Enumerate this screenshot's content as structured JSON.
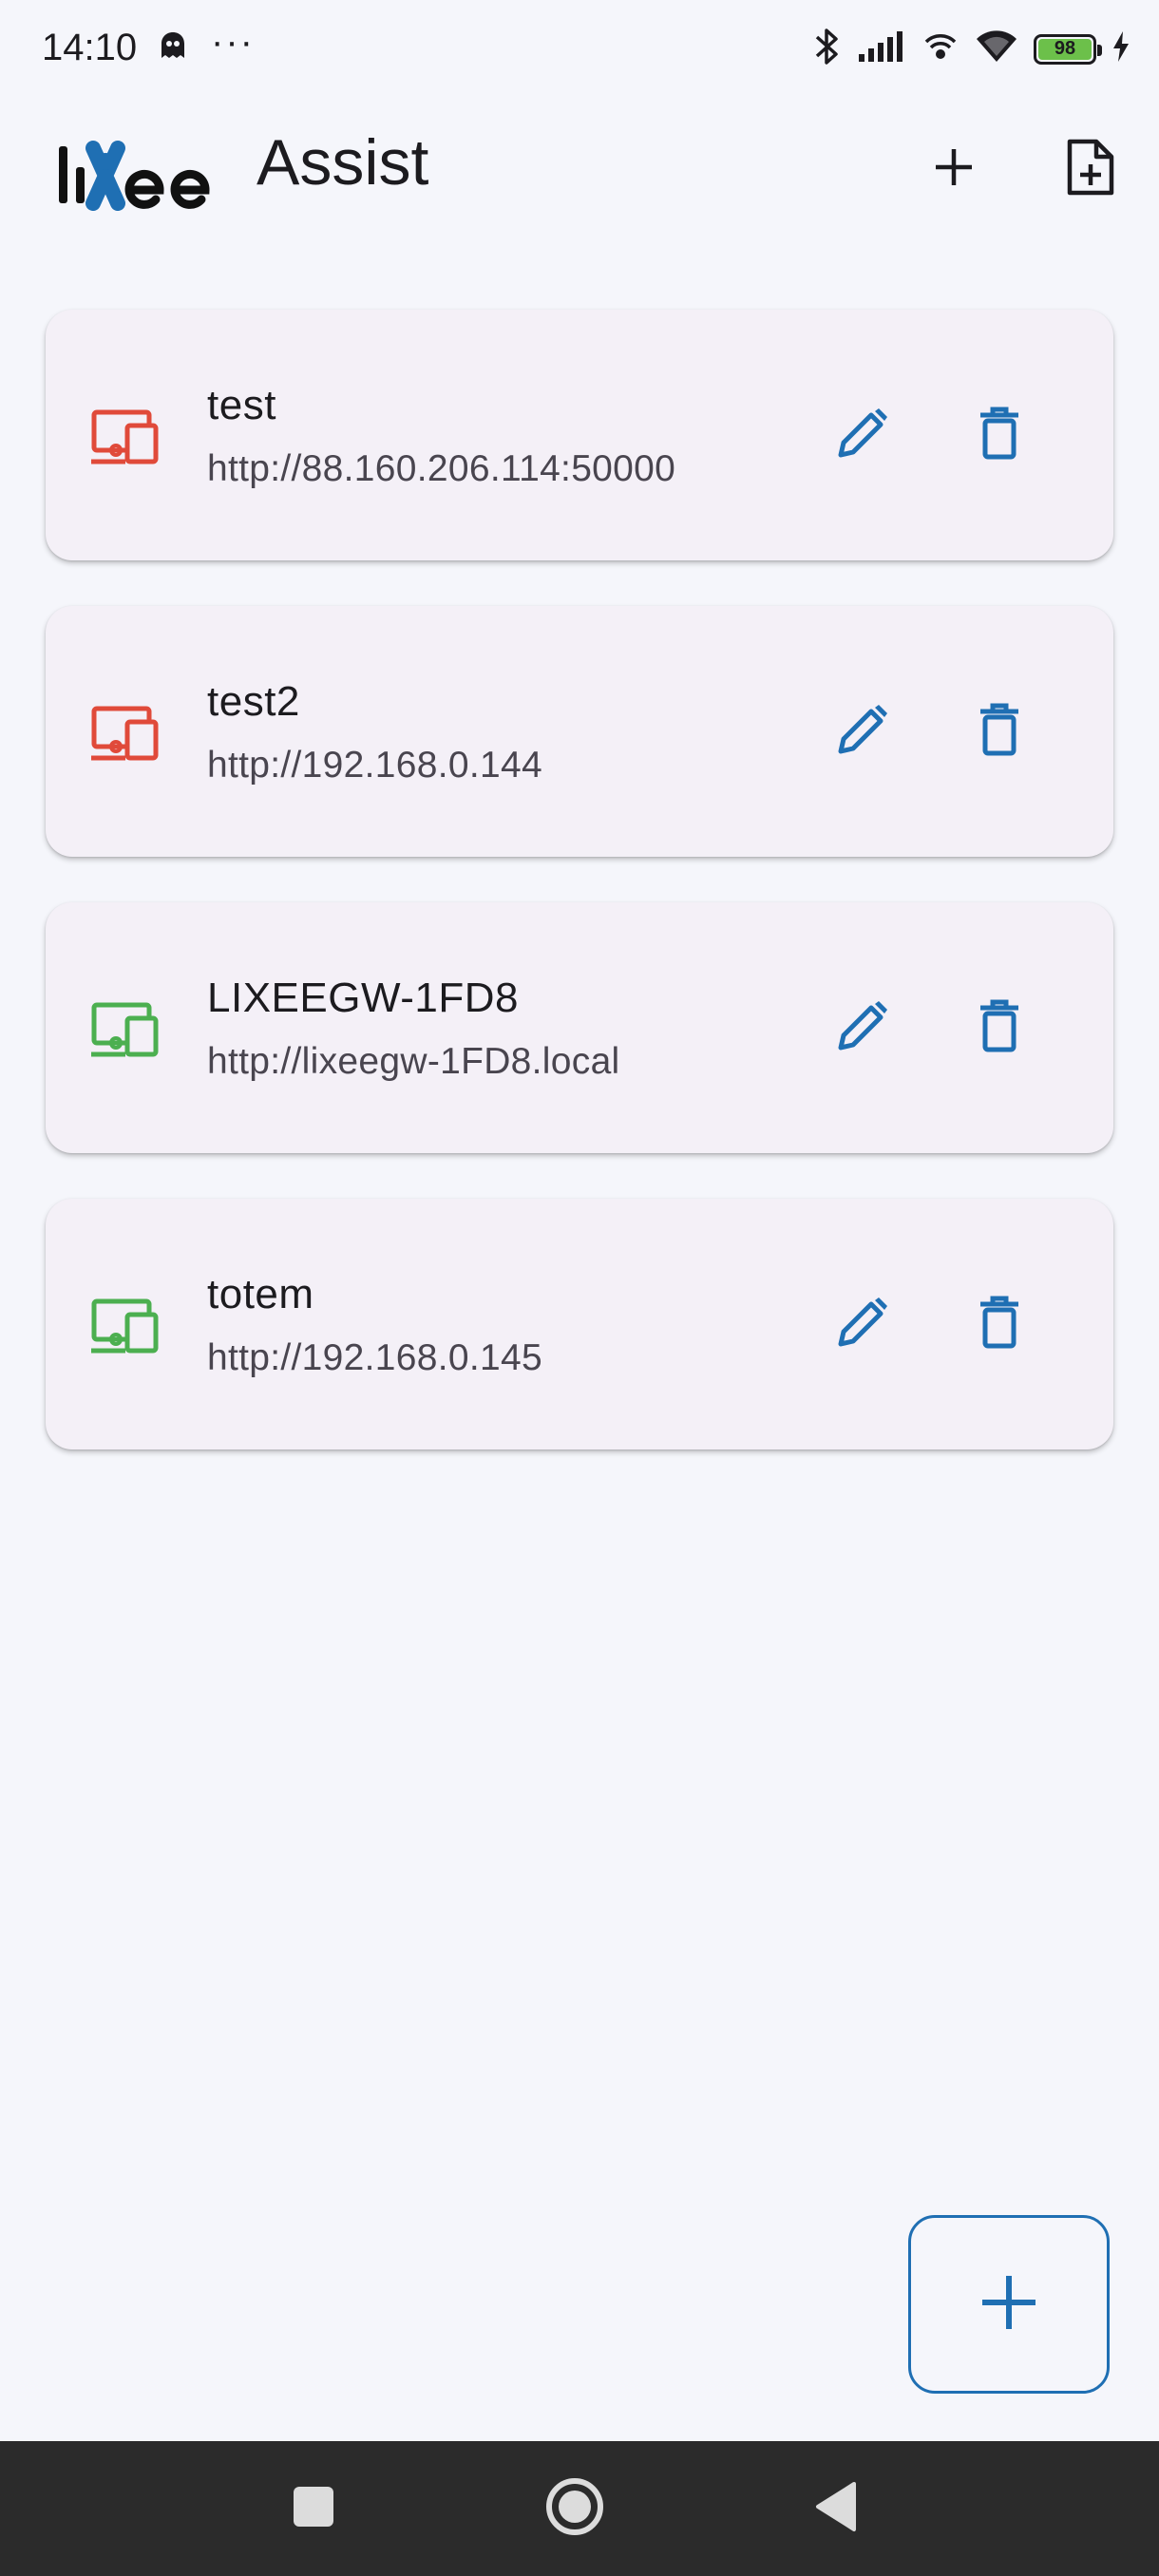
{
  "status_bar": {
    "time": "14:10",
    "more": "···",
    "battery": "98",
    "icons": [
      "ghost-icon",
      "bluetooth-icon",
      "signal-icon",
      "hotspot-icon",
      "wifi-icon",
      "battery-icon",
      "charging-icon"
    ]
  },
  "app_bar": {
    "logo_text": "lixee",
    "title": "Assist",
    "actions": [
      "add-icon",
      "file-add-icon"
    ]
  },
  "devices": [
    {
      "name": "test",
      "url": "http://88.160.206.114:50000",
      "status": "offline",
      "status_color": "#e04a3a"
    },
    {
      "name": "test2",
      "url": "http://192.168.0.144",
      "status": "offline",
      "status_color": "#e04a3a"
    },
    {
      "name": "LIXEEGW-1FD8",
      "url": "http://lixeegw-1FD8.local",
      "status": "online",
      "status_color": "#4caf50"
    },
    {
      "name": "totem",
      "url": "http://192.168.0.145",
      "status": "online",
      "status_color": "#4caf50"
    }
  ],
  "colors": {
    "accent": "#1f6fb3",
    "background": "#f5f6fb",
    "card": "#f4f0f7",
    "navbar": "#2b2b2b"
  },
  "fab": {
    "icon": "add-icon"
  },
  "nav_bar": {
    "icons": [
      "recent-apps-icon",
      "home-icon",
      "back-icon"
    ]
  }
}
